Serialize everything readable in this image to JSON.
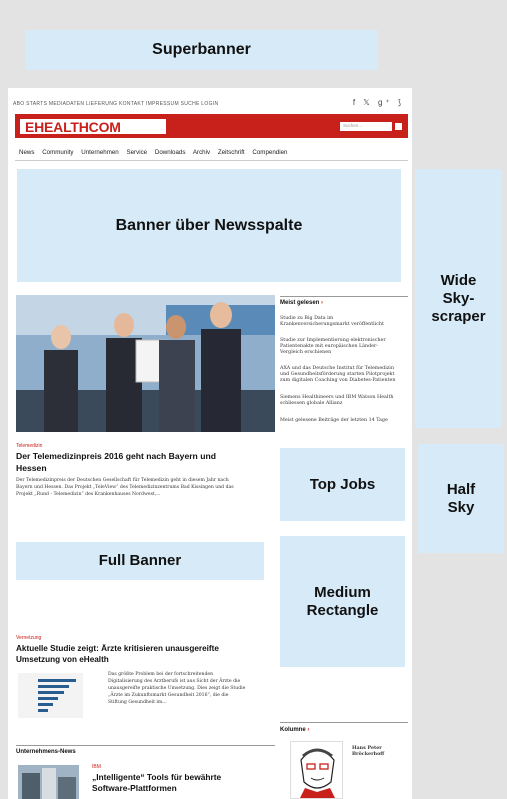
{
  "ads": {
    "superbanner": "Superbanner",
    "banner_news": "Banner über Newsspalte",
    "wide_sky_1": "Wide",
    "wide_sky_2": "Sky-",
    "wide_sky_3": "scraper",
    "top_jobs": "Top Jobs",
    "half_sky_1": "Half",
    "half_sky_2": "Sky",
    "full_banner": "Full Banner",
    "medium_rect_1": "Medium",
    "medium_rect_2": "Rectangle"
  },
  "site": {
    "top_links": "ABO  STARTS  MEDIADATEN  LIEFERUNG  KONTAKT  IMPRESSUM  SUCHE  LOGIN",
    "social": "f  𝕏  g⁺  ⟆",
    "logo": "EHEALTHCOM",
    "search_placeholder": "Suchen...",
    "nav": [
      "News",
      "Community",
      "Unternehmen",
      "Service",
      "Downloads",
      "Archiv",
      "Zeitschrift",
      "Compendien"
    ]
  },
  "article1": {
    "kicker": "Telemedizin",
    "headline_1": "Der Telemedizinpreis 2016 geht nach Bayern und",
    "headline_2": "Hessen",
    "teaser_1": "Der Telemedizinpreis der Deutschen Gesellschaft für Telemedizin geht in diesem Jahr nach",
    "teaser_2": "Bayern und Hessen. Das Projekt „TeleView“ des Telemedizinzentrums Bad Kissingen und das",
    "teaser_3": "Projekt „Rund - Telemedizin“ des Krankenhauses Nordwest,..."
  },
  "article2": {
    "kicker": "Vernetzung",
    "headline_1": "Aktuelle Studie zeigt: Ärzte kritisieren unausgereifte",
    "headline_2": "Umsetzung von eHealth",
    "teaser_1": "Das größte Problem bei der fortschreitenden",
    "teaser_2": "Digitalisierung des Arztberufs ist aus Sicht der Ärzte die",
    "teaser_3": "unausgereifte praktische Umsetzung. Dies zeigt die Studie",
    "teaser_4": "„Ärzte im Zukunftsmarkt Gesundheit 2016“, die die",
    "teaser_5": "Stiftung Gesundheit im..."
  },
  "sidebar": {
    "most_read_title": "Meist gelesen",
    "items": [
      [
        "Studie zu Big Data im",
        "Krankenversicherungsmarkt veröffentlicht"
      ],
      [
        "Studie zur Implementierung elektronischer",
        "Patientenakte mit europäischen Länder-",
        "Vergleich erschienen"
      ],
      [
        "AXA und das Deutsche Institut für Telemedizin",
        "und Gesundheitsförderung starten Pilotprojekt",
        "zum digitalen Coaching von Diabetes-Patienten"
      ],
      [
        "Siemens Healthineers und IBM Watson Health",
        "schliessen globale Allianz"
      ]
    ],
    "footer": "Meist gelesene Beiträge der letzten 14 Tage",
    "column_title": "Kolumne",
    "column_author_1": "Hans Peter",
    "column_author_2": "Bröckerhoff"
  },
  "company_news": {
    "title": "Unternehmens-News",
    "kicker": "IBM",
    "headline_1": "„Intelligente“ Tools für bewährte",
    "headline_2": "Software-Plattformen"
  }
}
